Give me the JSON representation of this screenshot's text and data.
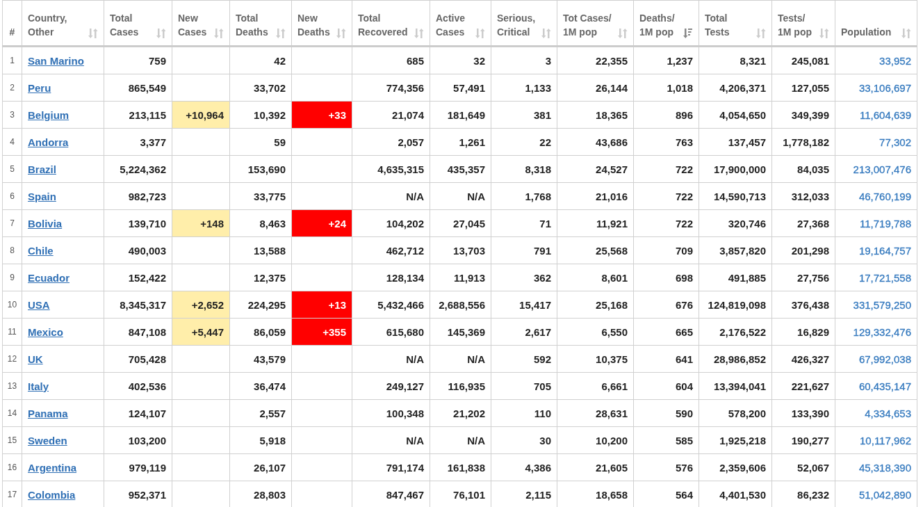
{
  "table": {
    "columns": [
      {
        "label": "#",
        "kind": "rank"
      },
      {
        "label": "Country,\nOther",
        "kind": "country",
        "sorted": false
      },
      {
        "label": "Total\nCases",
        "kind": "number",
        "sorted": false
      },
      {
        "label": "New\nCases",
        "kind": "new_cases",
        "sorted": false
      },
      {
        "label": "Total\nDeaths",
        "kind": "number",
        "sorted": false
      },
      {
        "label": "New\nDeaths",
        "kind": "new_deaths",
        "sorted": false
      },
      {
        "label": "Total\nRecovered",
        "kind": "number",
        "sorted": false
      },
      {
        "label": "Active\nCases",
        "kind": "number",
        "sorted": false
      },
      {
        "label": "Serious,\nCritical",
        "kind": "number",
        "sorted": false
      },
      {
        "label": "Tot Cases/\n1M pop",
        "kind": "number",
        "sorted": false
      },
      {
        "label": "Deaths/\n1M pop",
        "kind": "number",
        "sorted": true
      },
      {
        "label": "Total\nTests",
        "kind": "number",
        "sorted": false
      },
      {
        "label": "Tests/\n1M pop",
        "kind": "number",
        "sorted": false
      },
      {
        "label": "Population",
        "kind": "population",
        "sorted": false
      }
    ],
    "rows": [
      [
        "1",
        "San Marino",
        "759",
        null,
        "42",
        null,
        "685",
        "32",
        "3",
        "22,355",
        "1,237",
        "8,321",
        "245,081",
        "33,952"
      ],
      [
        "2",
        "Peru",
        "865,549",
        null,
        "33,702",
        null,
        "774,356",
        "57,491",
        "1,133",
        "26,144",
        "1,018",
        "4,206,371",
        "127,055",
        "33,106,697"
      ],
      [
        "3",
        "Belgium",
        "213,115",
        "+10,964",
        "10,392",
        "+33",
        "21,074",
        "181,649",
        "381",
        "18,365",
        "896",
        "4,054,650",
        "349,399",
        "11,604,639"
      ],
      [
        "4",
        "Andorra",
        "3,377",
        null,
        "59",
        null,
        "2,057",
        "1,261",
        "22",
        "43,686",
        "763",
        "137,457",
        "1,778,182",
        "77,302"
      ],
      [
        "5",
        "Brazil",
        "5,224,362",
        null,
        "153,690",
        null,
        "4,635,315",
        "435,357",
        "8,318",
        "24,527",
        "722",
        "17,900,000",
        "84,035",
        "213,007,476"
      ],
      [
        "6",
        "Spain",
        "982,723",
        null,
        "33,775",
        null,
        "N/A",
        "N/A",
        "1,768",
        "21,016",
        "722",
        "14,590,713",
        "312,033",
        "46,760,199"
      ],
      [
        "7",
        "Bolivia",
        "139,710",
        "+148",
        "8,463",
        "+24",
        "104,202",
        "27,045",
        "71",
        "11,921",
        "722",
        "320,746",
        "27,368",
        "11,719,788"
      ],
      [
        "8",
        "Chile",
        "490,003",
        null,
        "13,588",
        null,
        "462,712",
        "13,703",
        "791",
        "25,568",
        "709",
        "3,857,820",
        "201,298",
        "19,164,757"
      ],
      [
        "9",
        "Ecuador",
        "152,422",
        null,
        "12,375",
        null,
        "128,134",
        "11,913",
        "362",
        "8,601",
        "698",
        "491,885",
        "27,756",
        "17,721,558"
      ],
      [
        "10",
        "USA",
        "8,345,317",
        "+2,652",
        "224,295",
        "+13",
        "5,432,466",
        "2,688,556",
        "15,417",
        "25,168",
        "676",
        "124,819,098",
        "376,438",
        "331,579,250"
      ],
      [
        "11",
        "Mexico",
        "847,108",
        "+5,447",
        "86,059",
        "+355",
        "615,680",
        "145,369",
        "2,617",
        "6,550",
        "665",
        "2,176,522",
        "16,829",
        "129,332,476"
      ],
      [
        "12",
        "UK",
        "705,428",
        null,
        "43,579",
        null,
        "N/A",
        "N/A",
        "592",
        "10,375",
        "641",
        "28,986,852",
        "426,327",
        "67,992,038"
      ],
      [
        "13",
        "Italy",
        "402,536",
        null,
        "36,474",
        null,
        "249,127",
        "116,935",
        "705",
        "6,661",
        "604",
        "13,394,041",
        "221,627",
        "60,435,147"
      ],
      [
        "14",
        "Panama",
        "124,107",
        null,
        "2,557",
        null,
        "100,348",
        "21,202",
        "110",
        "28,631",
        "590",
        "578,200",
        "133,390",
        "4,334,653"
      ],
      [
        "15",
        "Sweden",
        "103,200",
        null,
        "5,918",
        null,
        "N/A",
        "N/A",
        "30",
        "10,200",
        "585",
        "1,925,218",
        "190,277",
        "10,117,962"
      ],
      [
        "16",
        "Argentina",
        "979,119",
        null,
        "26,107",
        null,
        "791,174",
        "161,838",
        "4,386",
        "21,605",
        "576",
        "2,359,606",
        "52,067",
        "45,318,390"
      ],
      [
        "17",
        "Colombia",
        "952,371",
        null,
        "28,803",
        null,
        "847,467",
        "76,101",
        "2,115",
        "18,658",
        "564",
        "4,401,530",
        "86,232",
        "51,042,890"
      ]
    ]
  }
}
